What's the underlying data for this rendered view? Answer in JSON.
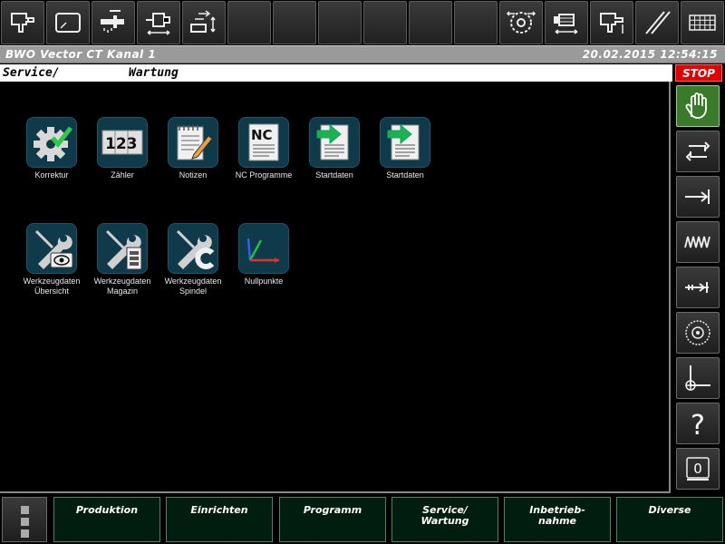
{
  "titlebar": {
    "title": "BWO Vector CT Kanal 1",
    "datetime": "20.02.2015 12:54:15"
  },
  "path": {
    "section": "Service/",
    "page": "Wartung"
  },
  "stop_label": "STOP",
  "toolbar": {
    "buttons": [
      {
        "icon": "spindle-tool-icon"
      },
      {
        "icon": "window-icon"
      },
      {
        "icon": "coolant-tap-icon"
      },
      {
        "icon": "tailstock-icon"
      },
      {
        "icon": "loader-icon"
      },
      {
        "icon": "empty"
      },
      {
        "icon": "empty"
      },
      {
        "icon": "empty"
      },
      {
        "icon": "empty"
      },
      {
        "icon": "empty"
      },
      {
        "icon": "empty"
      },
      {
        "icon": "grinding-wheel-icon"
      },
      {
        "icon": "workpiece-measure-icon"
      },
      {
        "icon": "tool-measure-icon"
      },
      {
        "icon": "parallel-lines-icon"
      },
      {
        "icon": "keyboard-icon"
      }
    ]
  },
  "apps": [
    {
      "label": "Korrektur"
    },
    {
      "label": "Zähler"
    },
    {
      "label": "Notizen"
    },
    {
      "label": "NC Programme"
    },
    {
      "label": "Startdaten"
    },
    {
      "label": "Startdaten"
    },
    {
      "label": "Werkzeugdaten\nÜbersicht"
    },
    {
      "label": "Werkzeugdaten\nMagazin"
    },
    {
      "label": "Werkzeugdaten\nSpindel"
    },
    {
      "label": "Nullpunkte"
    }
  ],
  "counter_digits": "123",
  "nc_text": "NC",
  "help_glyph": "?",
  "zero_glyph": "0",
  "nav": [
    {
      "label": "Produktion"
    },
    {
      "label": "Einrichten"
    },
    {
      "label": "Programm"
    },
    {
      "label": "Service/\nWartung"
    },
    {
      "label": "Inbetrieb-\nnahme"
    },
    {
      "label": "Diverse"
    }
  ],
  "colors": {
    "stop": "#e00000",
    "active_side": "#3b7a2a",
    "tile": "#0e3a4a",
    "nav_bg": "#001e10"
  }
}
